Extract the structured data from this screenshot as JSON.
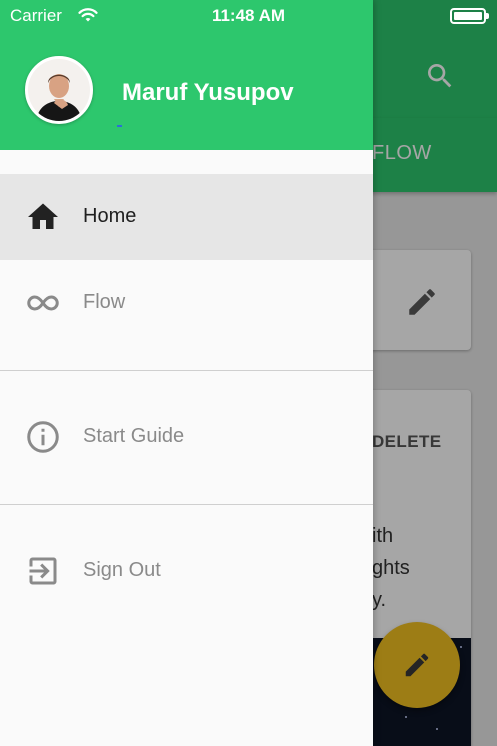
{
  "status_bar": {
    "carrier": "Carrier",
    "time": "11:48 AM"
  },
  "drawer": {
    "user_name": "Maruf Yusupov",
    "items": [
      {
        "label": "Home",
        "icon": "home-icon",
        "active": true
      },
      {
        "label": "Flow",
        "icon": "infinity-icon",
        "active": false
      },
      {
        "label": "Start Guide",
        "icon": "info-icon",
        "active": false
      },
      {
        "label": "Sign Out",
        "icon": "exit-icon",
        "active": false
      }
    ]
  },
  "background": {
    "tab_label": "FLOW",
    "card_action": "DELETE",
    "card_text_lines": [
      "ith",
      "ghts",
      "y."
    ]
  },
  "colors": {
    "primary": "#2dc76d",
    "fab": "#f2c021",
    "drawer_bg": "#fafafa",
    "active_item_bg": "#e6e6e6"
  }
}
